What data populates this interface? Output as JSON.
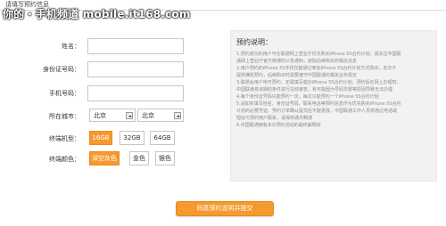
{
  "header": {
    "title": "请填写预约信息",
    "watermark": "你的・手机频道 mobile.it168.com"
  },
  "form": {
    "name_label": "姓名：",
    "id_label": "身份证号码：",
    "phone_label": "手机号码：",
    "city_label": "所在城市：",
    "province_value": "北京",
    "city_value": "北京",
    "model_label": "终端机型：",
    "models": [
      "16GB",
      "32GB",
      "64GB"
    ],
    "model_selected": "16GB",
    "color_label": "终端颜色：",
    "colors": [
      "深空灰色",
      "金色",
      "银色"
    ],
    "color_selected": "深空灰色"
  },
  "panel": {
    "title": "预约说明：",
    "items": [
      "1.预约成功的用户可在联通网上营业厅优先购买iPhone 5S合约计划，请关注中国联",
      "通网上营业厅官方微博的公告通知，获取后续购买的相关信息",
      "2.用户预约的iPhone 5S手机仅能通过参加iPhone 5S合约计划方式购买，本次不",
      "提供裸机预约，后续购买时需要遵守中国联通的相关业务规定",
      "3.联通会用户电可预约，无需填写或办iPhone 5S合约计划，预约后在网上办理时，",
      "中国联通将该期的条件进行在线审查，有可能因为号码交费等原因导致无法办理",
      "4.每个身份证号码只能预约一次，每次只能预约一个iPhone 5S合约计划",
      "5.请如实填写姓名、身份证号码、联系电话等预约信息作为优先购买iPhone 5S合约",
      "计划的必要凭证。预约订单确认提交后不能更改，中国联通工作人员将通过电话或",
      "短信与预约用户联系，请保持通讯畅通",
      "6.中国联通拥有本次预约活动的最终解释权"
    ]
  },
  "submit_label": "同意预约说明并提交",
  "colors": {
    "accent": "#f59a2f",
    "panel_bg": "#f2f2f2",
    "border": "#c6c6c6"
  }
}
